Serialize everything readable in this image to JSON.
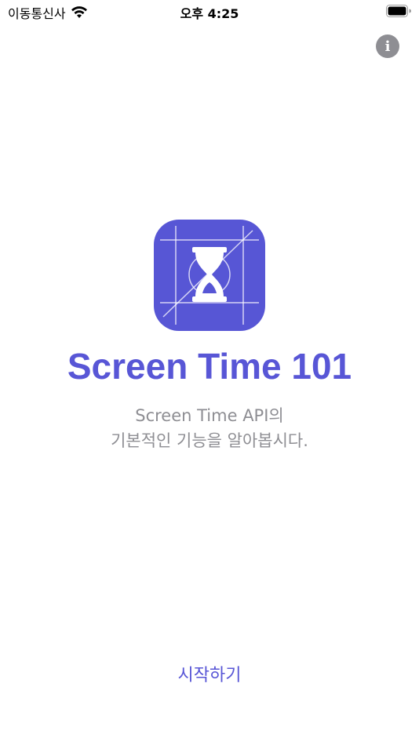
{
  "status_bar": {
    "carrier": "이동통신사",
    "time": "오후 4:25"
  },
  "app": {
    "title": "Screen Time 101",
    "subtitle_line1": "Screen Time API의",
    "subtitle_line2": "기본적인 기능을 알아봅시다.",
    "start_label": "시작하기",
    "info_glyph": "i",
    "accent_color": "#5856d6",
    "icons": [
      "wifi-icon",
      "battery-icon",
      "info-icon",
      "hourglass-icon"
    ]
  }
}
